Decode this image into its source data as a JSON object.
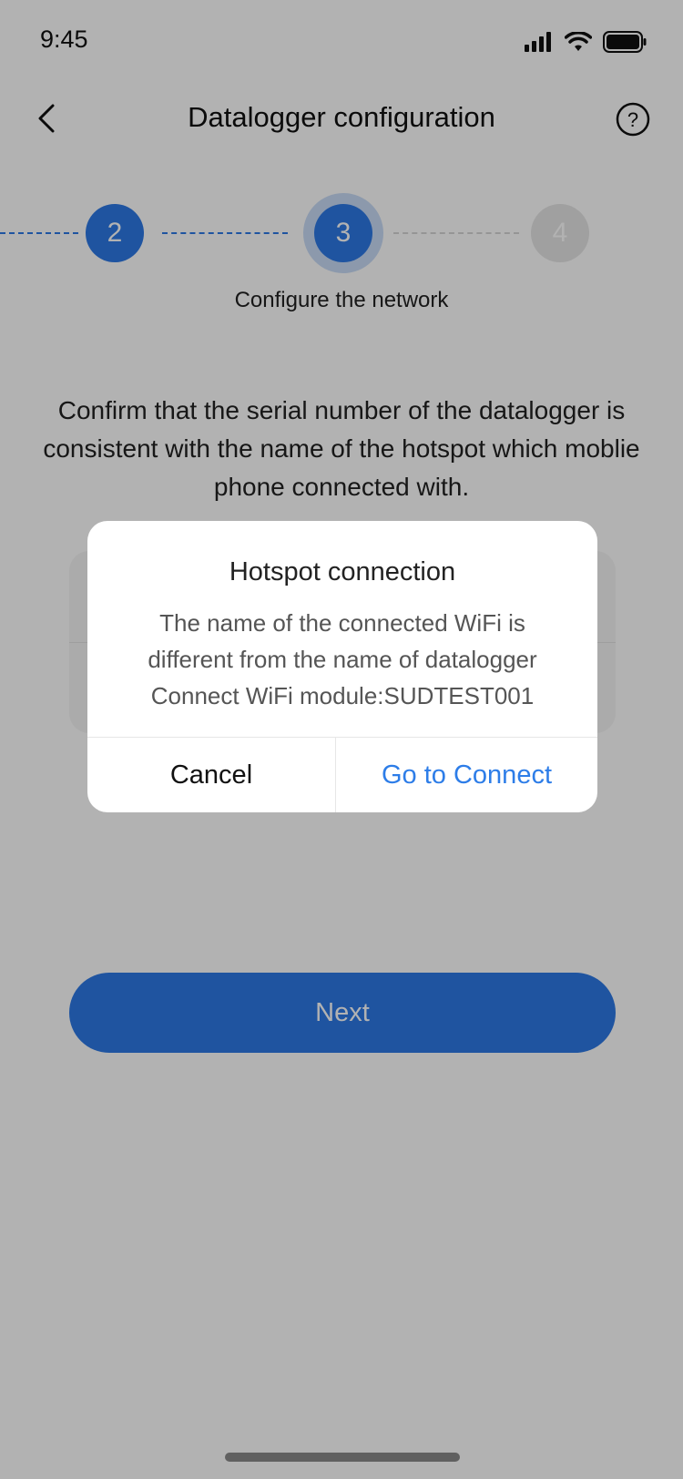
{
  "status_bar": {
    "time": "9:45"
  },
  "header": {
    "title": "Datalogger configuration",
    "back_icon": "chevron-left-icon",
    "help_icon": "question-circle-icon"
  },
  "stepper": {
    "steps": [
      {
        "number": "2",
        "state": "completed"
      },
      {
        "number": "3",
        "state": "active"
      },
      {
        "number": "4",
        "state": "pending"
      }
    ],
    "caption": "Configure the network"
  },
  "instruction": "Confirm that the serial number of the datalogger is consistent with the name of the hotspot which moblie phone connected with.",
  "next_button": {
    "label": "Next"
  },
  "dialog": {
    "title": "Hotspot connection",
    "message_lines": [
      "The name of the connected WiFi is",
      "different from the name of datalogger",
      "Connect WiFi module:SUDTEST001"
    ],
    "cancel_label": "Cancel",
    "confirm_label": "Go to Connect"
  },
  "colors": {
    "accent": "#2d79e6",
    "link": "#2d7de8",
    "overlay": "rgba(0,0,0,0.3)"
  }
}
